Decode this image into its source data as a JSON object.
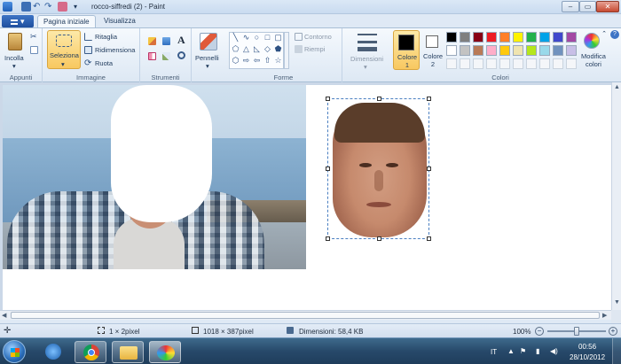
{
  "window": {
    "title": "rocco-siffredi (2) - Paint",
    "controls": {
      "minimize": "–",
      "maximize": "▭",
      "close": "✕"
    }
  },
  "tabs": {
    "file": "▾",
    "home": "Pagina iniziale",
    "view": "Visualizza"
  },
  "ribbon": {
    "clipboard": {
      "paste": "Incolla",
      "group": "Appunti"
    },
    "image": {
      "select": "Seleziona",
      "crop": "Ritaglia",
      "resize": "Ridimensiona",
      "rotate": "Ruota",
      "group": "Immagine"
    },
    "tools": {
      "group": "Strumenti"
    },
    "brushes": {
      "label": "Pennelli"
    },
    "shapes": {
      "outline": "Contorno",
      "fill": "Riempi",
      "group": "Forme"
    },
    "size": {
      "label": "Dimensioni"
    },
    "colors": {
      "color1": "Colore 1",
      "color2": "Colore 2",
      "edit": "Modifica colori",
      "group": "Colori",
      "palette_row1": [
        "#000000",
        "#7f7f7f",
        "#880015",
        "#ed1c24",
        "#ff7f27",
        "#fff200",
        "#22b14c",
        "#00a2e8",
        "#3f48cc",
        "#a349a4"
      ],
      "palette_row2": [
        "#ffffff",
        "#c3c3c3",
        "#b97a57",
        "#ffaec9",
        "#ffc90e",
        "#efe4b0",
        "#b5e61d",
        "#99d9ea",
        "#7092be",
        "#c8bfe7"
      ]
    }
  },
  "status": {
    "cursor_icon": "move-icon",
    "selection": "1 × 2pixel",
    "image_size": "1018 × 387pixel",
    "file_size": "Dimensioni: 58,4 KB",
    "zoom": "100%",
    "zoom_level": 0.5
  },
  "taskbar": {
    "language": "IT",
    "time": "00:56",
    "date": "28/10/2012"
  }
}
